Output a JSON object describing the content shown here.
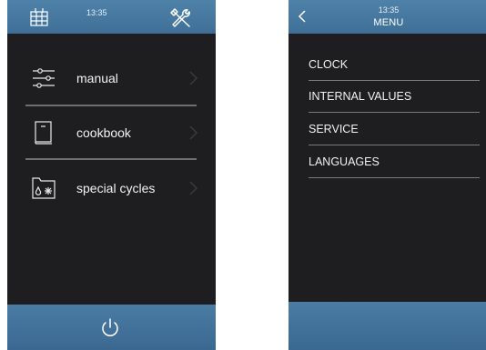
{
  "left_screen": {
    "header": {
      "time": "13:35",
      "calendar_icon": "calendar-icon",
      "tools_icon": "tools-icon"
    },
    "menu": [
      {
        "label": "manual",
        "icon": "sliders-icon"
      },
      {
        "label": "cookbook",
        "icon": "book-icon"
      },
      {
        "label": "special cycles",
        "icon": "folder-drop-snow-icon"
      }
    ],
    "footer": {
      "power_icon": "power-icon"
    }
  },
  "right_screen": {
    "header": {
      "time": "13:35",
      "title": "MENU",
      "back_icon": "chevron-left-icon"
    },
    "menu": [
      {
        "label": "CLOCK"
      },
      {
        "label": "INTERNAL VALUES"
      },
      {
        "label": "SERVICE"
      },
      {
        "label": "LANGUAGES"
      }
    ]
  },
  "colors": {
    "bar_blue": "#4a7ca4",
    "background": "#1e1e20",
    "divider": "#6f6f72",
    "text": "#f2f2f2"
  }
}
